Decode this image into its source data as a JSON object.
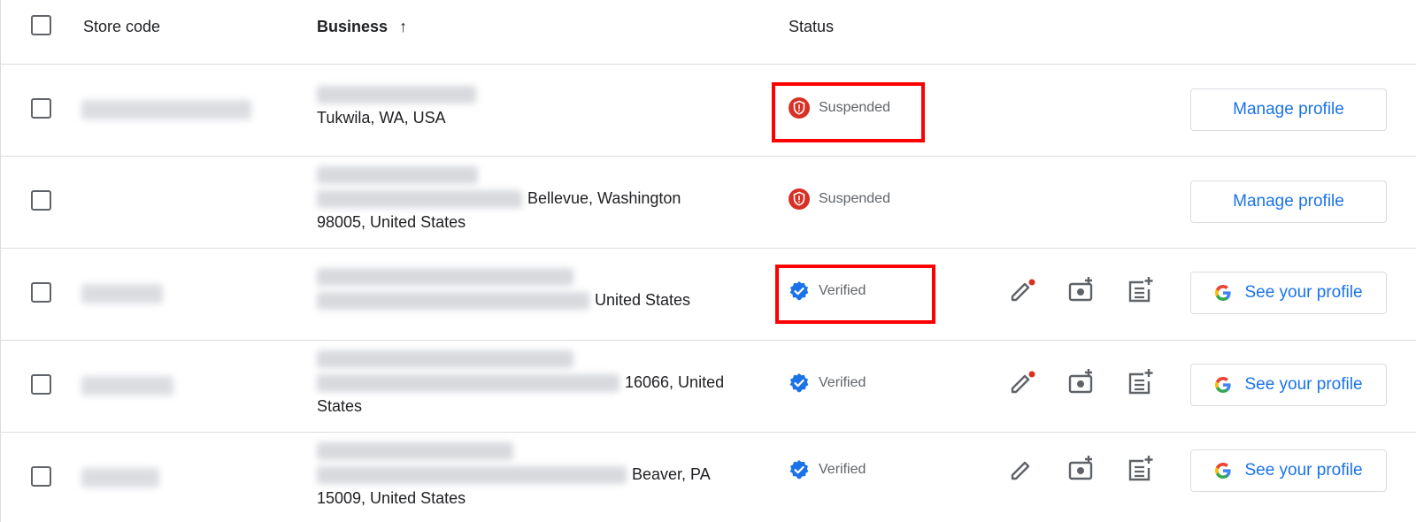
{
  "header": {
    "store_code": "Store code",
    "business": "Business",
    "sort_arrow": "↑",
    "status": "Status"
  },
  "rows": [
    {
      "location_line_1": "Tukwila, WA, USA",
      "status": "Suspended",
      "button": "Manage profile"
    },
    {
      "location_tail_1": "Bellevue, Washington",
      "location_line_2": "98005, United States",
      "status": "Suspended",
      "button": "Manage profile"
    },
    {
      "location_tail_1": "United States",
      "status": "Verified",
      "button": "See your profile"
    },
    {
      "location_tail_1": "16066, United",
      "location_line_2": "States",
      "status": "Verified",
      "button": "See your profile"
    },
    {
      "location_tail_1": "Beaver, PA",
      "location_line_2": "15009, United States",
      "status": "Verified",
      "button": "See your profile"
    }
  ],
  "colors": {
    "suspended": "#d93025",
    "verified": "#1a73e8",
    "highlight": "#ff0000",
    "link": "#1a73e8"
  },
  "icons": [
    "edit-icon",
    "add-photo-icon",
    "add-post-icon",
    "google-logo-icon",
    "suspended-shield-icon",
    "verified-badge-icon"
  ]
}
